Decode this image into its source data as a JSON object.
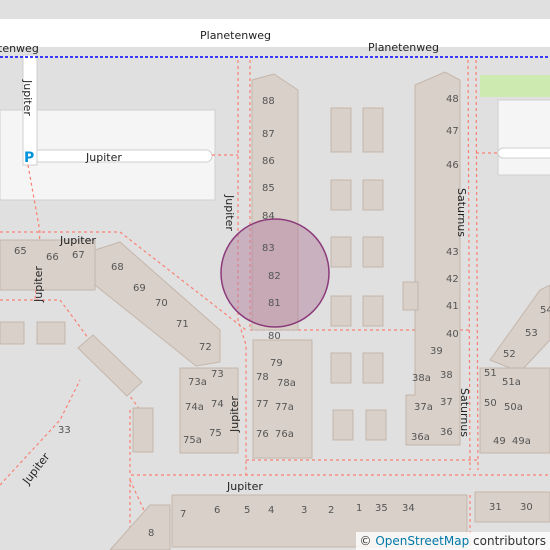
{
  "map": {
    "streets": {
      "planetenweg_main": "Planetenweg",
      "planetenweg_path": "Planetenweg",
      "planetenweg_left": "tenweg",
      "jupiter_top_left_vertical": "Jupiter",
      "jupiter_parking_road": "Jupiter",
      "jupiter_vertical_mid": "Jupiter",
      "jupiter_upper_left": "Jupiter",
      "jupiter_left_vertical": "Jupiter",
      "jupiter_lower_left": "Jupiter",
      "jupiter_lower_mid": "Jupiter",
      "jupiter_bottom": "Jupiter",
      "saturnus_upper": "Saturnus",
      "saturnus_lower": "Saturnus"
    },
    "parking_symbol": "P",
    "house_numbers": {
      "h88": "88",
      "h87": "87",
      "h86": "86",
      "h85": "85",
      "h84": "84",
      "h83": "83",
      "h82": "82",
      "h81": "81",
      "h80": "80",
      "h79": "79",
      "h78": "78",
      "h78a": "78a",
      "h77": "77",
      "h77a": "77a",
      "h76": "76",
      "h76a": "76a",
      "h48": "48",
      "h47": "47",
      "h46": "46",
      "h43": "43",
      "h42": "42",
      "h41": "41",
      "h40": "40",
      "h39": "39",
      "h38a": "38a",
      "h38": "38",
      "h37a": "37a",
      "h37": "37",
      "h36a": "36a",
      "h36": "36",
      "h65": "65",
      "h66": "66",
      "h67": "67",
      "h68": "68",
      "h69": "69",
      "h70": "70",
      "h71": "71",
      "h72": "72",
      "h73": "73",
      "h73a": "73a",
      "h74": "74",
      "h74a": "74a",
      "h75": "75",
      "h75a": "75a",
      "h33": "33",
      "h54": "54",
      "h53": "53",
      "h52": "52",
      "h51": "51",
      "h51a": "51a",
      "h50": "50",
      "h50a": "50a",
      "h49": "49",
      "h49a": "49a",
      "h8": "8",
      "h7": "7",
      "h6": "6",
      "h5": "5",
      "h4": "4",
      "h3": "3",
      "h2": "2",
      "h1": "1",
      "h35": "35",
      "h34": "34",
      "h31": "31",
      "h30": "30"
    },
    "attribution": {
      "copyright": "© ",
      "link_text": "OpenStreetMap",
      "suffix": " contributors"
    },
    "colors": {
      "background": "#e0e0e0",
      "building": "#d9d0c9",
      "building_stroke": "#c4b6ab",
      "road": "#ffffff",
      "footway": "#fa8072",
      "cycleway": "#0000ff",
      "grass": "#cdebb0",
      "highlight_fill": "#b482a0",
      "highlight_stroke": "#8b3a7a"
    }
  }
}
